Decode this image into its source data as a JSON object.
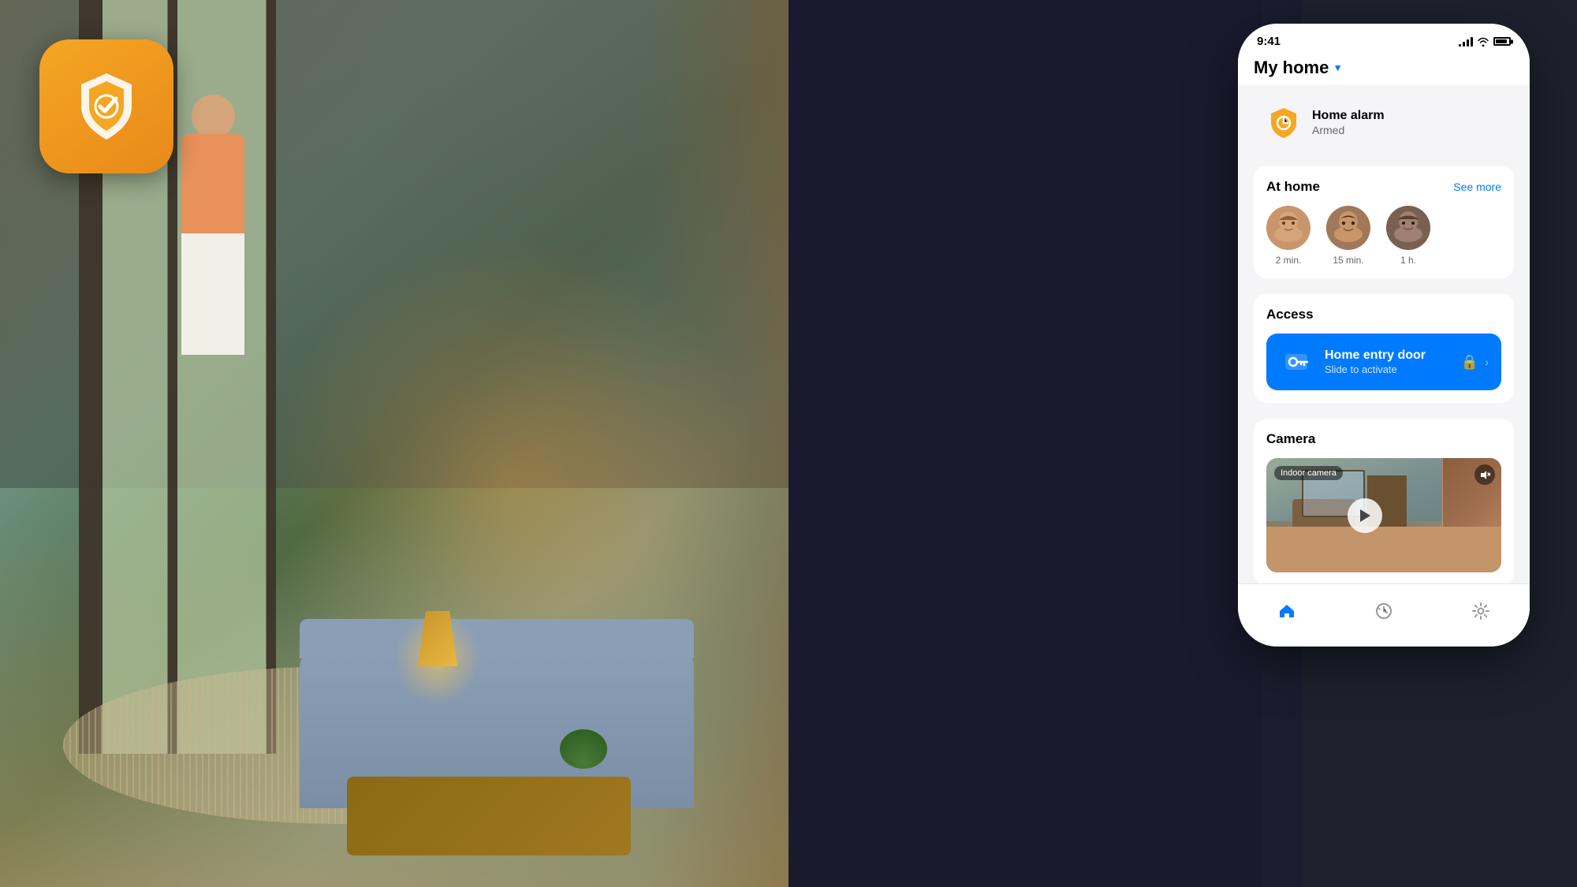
{
  "app": {
    "icon_alt": "Security app icon",
    "shield_color": "#f5a623"
  },
  "phone": {
    "status_bar": {
      "time": "9:41",
      "signal_label": "signal",
      "wifi_label": "wifi",
      "battery_label": "battery"
    },
    "header": {
      "title": "My home",
      "dropdown_label": "dropdown"
    },
    "alarm_section": {
      "title": "Home alarm",
      "status": "Armed"
    },
    "at_home_section": {
      "title": "At home",
      "see_more": "See more",
      "members": [
        {
          "time": "2 min.",
          "id": "1"
        },
        {
          "time": "15 min.",
          "id": "2"
        },
        {
          "time": "1 h.",
          "id": "3"
        }
      ]
    },
    "access_section": {
      "title": "Access",
      "door_title": "Home entry door",
      "door_subtitle": "Slide to activate"
    },
    "camera_section": {
      "title": "Camera",
      "label": "Indoor camera",
      "play_label": "▶",
      "mute_label": "🔇"
    },
    "nav": {
      "home": "home",
      "history": "history",
      "settings": "settings"
    }
  }
}
